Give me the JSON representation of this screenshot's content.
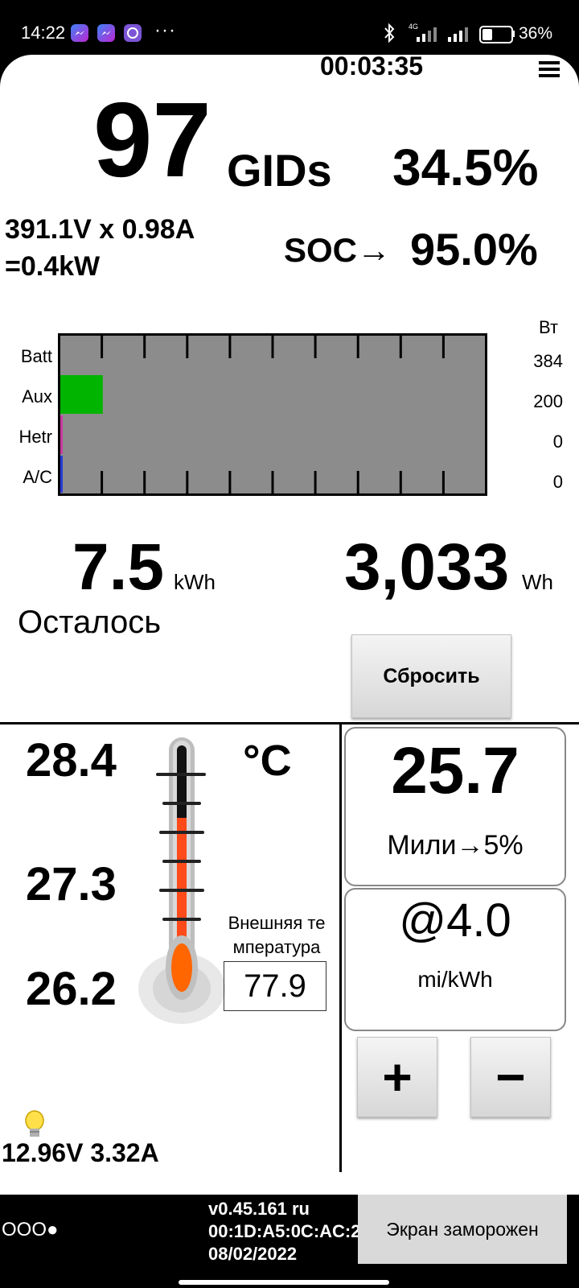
{
  "status_bar": {
    "time": "14:22",
    "more": "···",
    "signal_label": "4G",
    "battery_pct": "36%",
    "battery_level": 0.36
  },
  "header": {
    "timer": "00:03:35"
  },
  "top": {
    "gids_value": "97",
    "gids_unit": "GIDs",
    "gids_pct": "34.5%",
    "voltage_current": "391.1V x 0.98A",
    "power": "=0.4kW",
    "soc_label": "SOC→",
    "soc_value": "95.0%"
  },
  "power_bars": {
    "unit": "Вт",
    "rows": [
      {
        "label": "Batt",
        "value": "384"
      },
      {
        "label": "Aux",
        "value": "200"
      },
      {
        "label": "Hetr",
        "value": "0"
      },
      {
        "label": "A/C",
        "value": "0"
      }
    ],
    "aux_fill": 0.1,
    "colors": {
      "background": "#8c8c8c",
      "aux": "#00b400",
      "hetr": "#c83ca0",
      "ac": "#2a3bd6"
    }
  },
  "energy": {
    "remaining_value": "7.5",
    "remaining_unit": "kWh",
    "remaining_label": "Осталось",
    "used_value": "3,033",
    "used_unit": "Wh",
    "reset_label": "Сбросить"
  },
  "temps": {
    "high": "28.4",
    "mid": "27.3",
    "low": "26.2",
    "unit": "°C",
    "outside_label_line1": "Внешняя те",
    "outside_label_line2": "мпература",
    "outside_value": "77.9",
    "aux_battery": "12.96V 3.32A"
  },
  "range": {
    "value": "25.7",
    "label": "Мили→",
    "label_pct": "5%",
    "efficiency_value": "@4.0",
    "efficiency_unit": "mi/kWh",
    "plus_label": "+",
    "minus_label": "−"
  },
  "footer": {
    "dots": "OOO●",
    "version": "v0.45.161 ru",
    "mac": "00:1D:A5:0C:AC:2",
    "date": "08/02/2022",
    "frozen_label": "Экран заморожен"
  }
}
